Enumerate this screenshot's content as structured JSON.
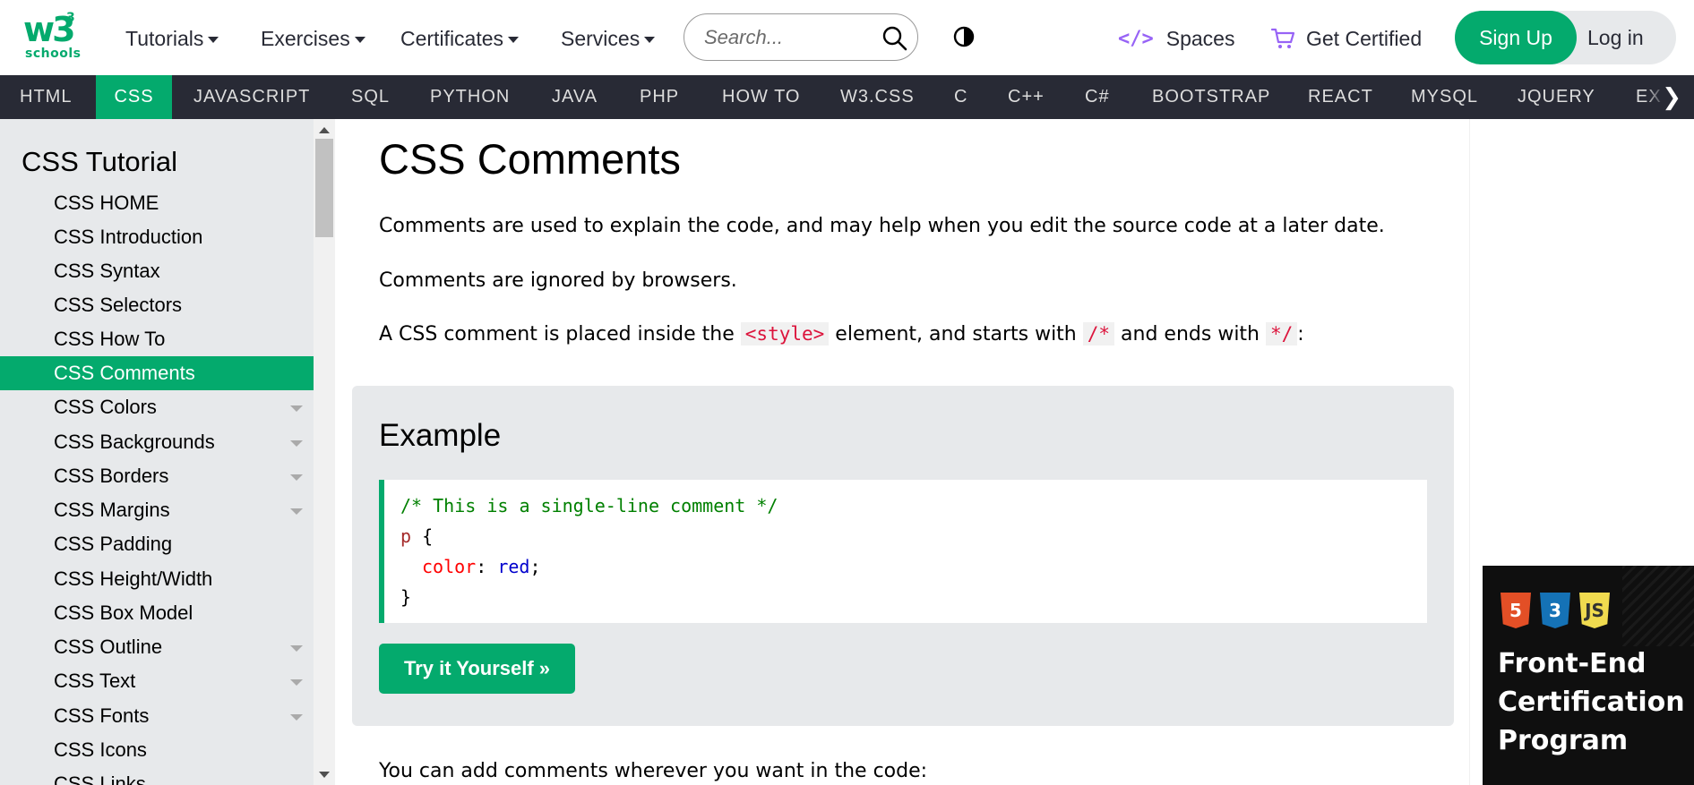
{
  "header": {
    "logo_main": "w3",
    "logo_sup": "3",
    "logo_sub": "schools",
    "nav": [
      {
        "label": "Tutorials"
      },
      {
        "label": "Exercises"
      },
      {
        "label": "Certificates"
      },
      {
        "label": "Services"
      }
    ],
    "search_placeholder": "Search...",
    "spaces_label": "Spaces",
    "certified_label": "Get Certified",
    "signup_label": "Sign Up",
    "login_label": "Log in",
    "accent_color": "#04aa6d"
  },
  "langbar": {
    "items": [
      "HTML",
      "CSS",
      "JAVASCRIPT",
      "SQL",
      "PYTHON",
      "JAVA",
      "PHP",
      "HOW TO",
      "W3.CSS",
      "C",
      "C++",
      "C#",
      "BOOTSTRAP",
      "REACT",
      "MYSQL",
      "JQUERY",
      "EX"
    ],
    "active": "CSS"
  },
  "sidebar": {
    "title": "CSS Tutorial",
    "items": [
      {
        "label": "CSS HOME",
        "expandable": false
      },
      {
        "label": "CSS Introduction",
        "expandable": false
      },
      {
        "label": "CSS Syntax",
        "expandable": false
      },
      {
        "label": "CSS Selectors",
        "expandable": false
      },
      {
        "label": "CSS How To",
        "expandable": false
      },
      {
        "label": "CSS Comments",
        "expandable": false,
        "active": true
      },
      {
        "label": "CSS Colors",
        "expandable": true
      },
      {
        "label": "CSS Backgrounds",
        "expandable": true
      },
      {
        "label": "CSS Borders",
        "expandable": true
      },
      {
        "label": "CSS Margins",
        "expandable": true
      },
      {
        "label": "CSS Padding",
        "expandable": false
      },
      {
        "label": "CSS Height/Width",
        "expandable": false
      },
      {
        "label": "CSS Box Model",
        "expandable": false
      },
      {
        "label": "CSS Outline",
        "expandable": true
      },
      {
        "label": "CSS Text",
        "expandable": true
      },
      {
        "label": "CSS Fonts",
        "expandable": true
      },
      {
        "label": "CSS Icons",
        "expandable": false
      },
      {
        "label": "CSS Links",
        "expandable": false
      }
    ]
  },
  "main": {
    "title": "CSS Comments",
    "p1": "Comments are used to explain the code, and may help when you edit the source code at a later date.",
    "p2": "Comments are ignored by browsers.",
    "p3_a": "A CSS comment is placed inside the ",
    "p3_code1": "<style>",
    "p3_b": " element, and starts with ",
    "p3_code2": "/*",
    "p3_c": " and ends with ",
    "p3_code3": "*/",
    "p3_d": ":",
    "example_title": "Example",
    "code": {
      "line1": "/* This is a single-line comment */",
      "line2_sel": "p",
      "line2_brace": " {",
      "line3_prop": "color",
      "line3_colon": ": ",
      "line3_val": "red",
      "line3_end": ";",
      "line4": "}"
    },
    "tryit_label": "Try it Yourself »",
    "p4": "You can add comments wherever you want in the code:"
  },
  "ad": {
    "badge1": "5",
    "badge2": "3",
    "badge3": "JS",
    "title": "Front-End Certification Program"
  }
}
